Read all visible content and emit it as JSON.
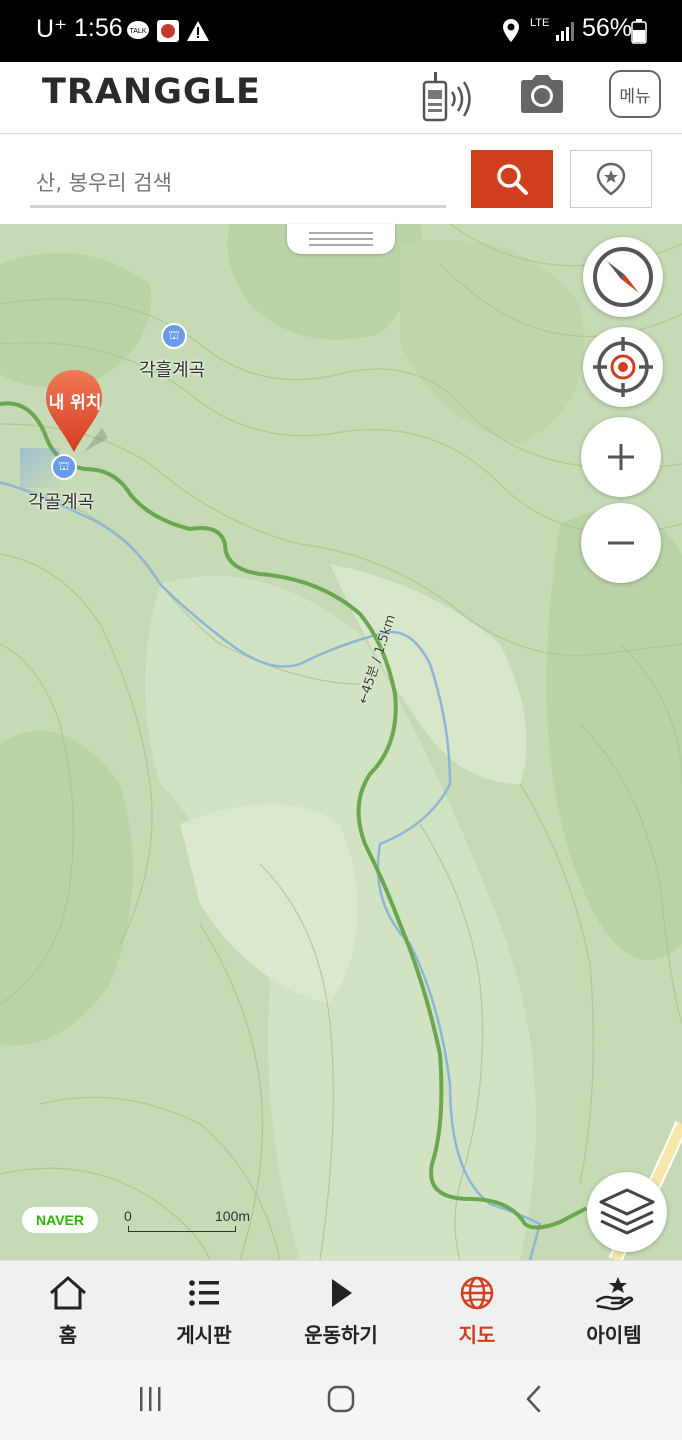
{
  "status_bar": {
    "carrier": "U⁺",
    "time": "1:56",
    "network": "LTE",
    "battery": "56%"
  },
  "header": {
    "logo": "TRANGGLE",
    "menu_label": "메뉴"
  },
  "search": {
    "placeholder": "산, 봉우리 검색"
  },
  "map": {
    "labels": {
      "poi_1": "각흘계곡",
      "poi_2": "각골계곡",
      "my_location": "내 위치",
      "route": "←45분 / 1.5km"
    },
    "attribution": "NAVER",
    "scale": {
      "start": "0",
      "end": "100m"
    }
  },
  "tabs": [
    {
      "label": "홈",
      "icon": "home-icon"
    },
    {
      "label": "게시판",
      "icon": "list-icon"
    },
    {
      "label": "운동하기",
      "icon": "play-icon"
    },
    {
      "label": "지도",
      "icon": "globe-icon",
      "active": true
    },
    {
      "label": "아이템",
      "icon": "hand-star-icon"
    }
  ],
  "colors": {
    "accent": "#d0401e",
    "map_green": "#c5dab5",
    "trail": "#6aa84f",
    "stream": "#8fb5d6"
  }
}
